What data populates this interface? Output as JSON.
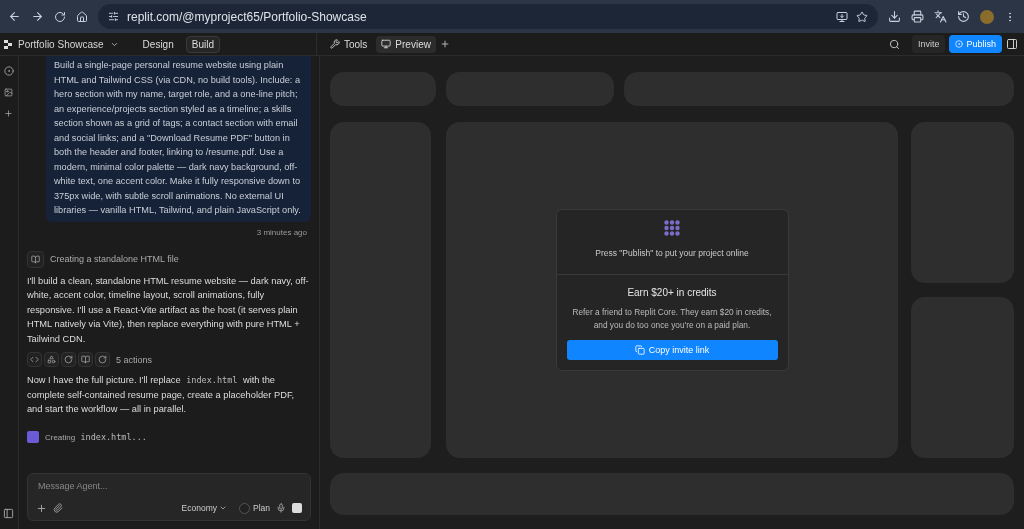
{
  "browser": {
    "url": "replit.com/@myproject65/Portfolio-Showcase"
  },
  "header": {
    "project": "Portfolio Showcase",
    "modes": [
      {
        "label": "Design",
        "selected": false
      },
      {
        "label": "Build",
        "selected": true
      }
    ],
    "panels": [
      {
        "label": "Tools",
        "kind": "tools",
        "selected": false
      },
      {
        "label": "Preview",
        "kind": "preview",
        "selected": true
      }
    ],
    "invite": "Invite",
    "publish": "Publish"
  },
  "chat": {
    "user_message": "Build a single-page personal resume website using plain HTML and Tailwind CSS (via CDN, no build tools). Include: a hero section with my name, target role, and a one-line pitch; an experience/projects section styled as a timeline; a skills section shown as a grid of tags; a contact section with email and social links; and a \"Download Resume PDF\" button in both the header and footer, linking to /resume.pdf. Use a modern, minimal color palette — dark navy background, off-white text, one accent color. Make it fully responsive down to 375px wide, with subtle scroll animations. No external UI libraries — vanilla HTML, Tailwind, and plain JavaScript only.",
    "timestamp": "3 minutes ago",
    "status": "Creating a standalone HTML file",
    "reply": "I'll build a clean, standalone HTML resume website — dark navy, off-white, accent color, timeline layout, scroll animations, fully responsive. I'll use a React-Vite artifact as the host (it serves plain HTML natively via Vite), then replace everything with pure HTML + Tailwind CDN.",
    "actions": "5 actions",
    "reply2": [
      {
        "kind": "text",
        "text": "Now I have the full picture. I'll replace "
      },
      {
        "kind": "code",
        "text": "index.html"
      },
      {
        "kind": "text",
        "text": " with the complete self-contained resume page, create a placeholder PDF, and start the workflow — all in parallel."
      }
    ],
    "working": [
      {
        "kind": "text",
        "text": "Creating "
      },
      {
        "kind": "code",
        "text": "index.html..."
      }
    ],
    "input": {
      "placeholder": "Message Agent...",
      "mode": "Economy",
      "plan": "Plan",
      "plan_on": false
    }
  },
  "preview": {
    "message": "Press \"Publish\" to put your project online",
    "title": "Earn $20+ in credits",
    "text": "Refer a friend to Replit Core. They earn $20 in credits, and you do too once you're on a paid plan.",
    "button": "Copy invite link"
  }
}
